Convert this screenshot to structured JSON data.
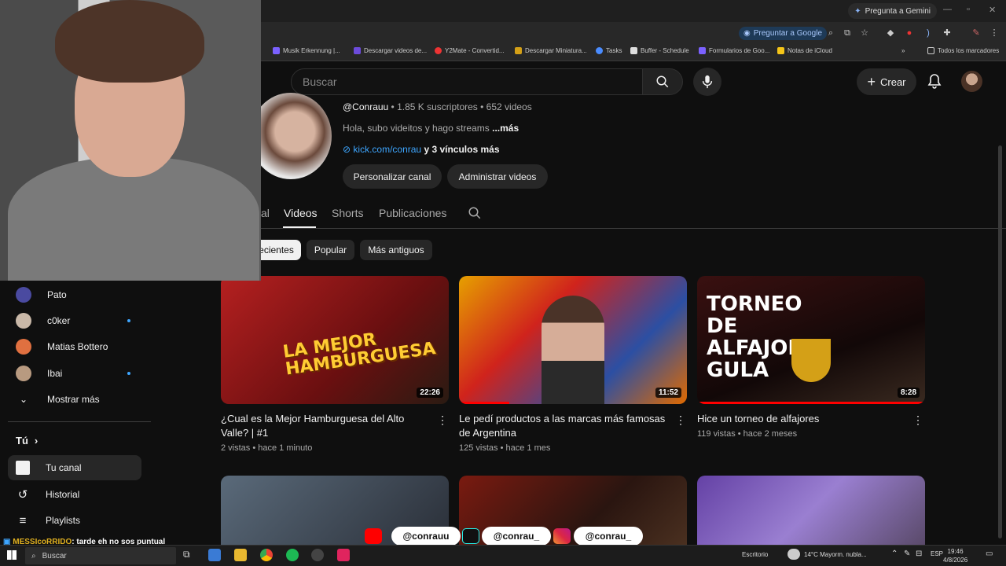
{
  "browser": {
    "gemini_label": "Pregunta a Gemini",
    "google_button": "Preguntar a Google",
    "bookmarks": [
      "Musik Erkennung |...",
      "Descargar videos de...",
      "Y2Mate - Convertid...",
      "Descargar Miniatura...",
      "Tasks",
      "Buffer - Schedule",
      "Formularios de Goo...",
      "Notas de iCloud"
    ],
    "bookmarks_overflow": "»",
    "all_bookmarks": "Todos los marcadores"
  },
  "header": {
    "search_placeholder": "Buscar",
    "create_label": "Crear"
  },
  "channel": {
    "handle": "@Conrauu",
    "stats": " • 1.85 K suscriptores • 652 videos",
    "description": "Hola, subo videitos y hago streams ",
    "more": "...más",
    "link": "kick.com/conrau",
    "more_links": " y 3 vínculos más",
    "customize_button": "Personalizar canal",
    "manage_button": "Administrar videos",
    "tabs": [
      "al",
      "Videos",
      "Shorts",
      "Publicaciones"
    ],
    "chips": [
      "ecientes",
      "Popular",
      "Más antiguos"
    ]
  },
  "sidebar": {
    "subscriptions": [
      {
        "name": "Pato"
      },
      {
        "name": "c0ker"
      },
      {
        "name": "Matias Bottero"
      },
      {
        "name": "Ibai"
      }
    ],
    "show_more": "Mostrar más",
    "you_label": "Tú",
    "nav": [
      "Tu canal",
      "Historial",
      "Playlists"
    ]
  },
  "videos": [
    {
      "title": "¿Cual es la Mejor Hamburguesa del Alto Valle? | #1",
      "meta": "2 vistas • hace 1 minuto",
      "duration": "22:26",
      "thumb_text": "LA MEJOR HAMBURGUESA",
      "progress": 0
    },
    {
      "title": "Le pedí productos a las marcas más famosas de Argentina",
      "meta": "125 vistas • hace 1 mes",
      "duration": "11:52",
      "thumb_text": "",
      "progress": 0.22
    },
    {
      "title": "Hice un torneo de alfajores",
      "meta": "119 vistas • hace 2 meses",
      "duration": "8:28",
      "thumb_text": "TORNEO DE ALFAJORES GULA",
      "progress": 1
    }
  ],
  "social": [
    "@conrauu",
    "@conrau_",
    "@conrau_"
  ],
  "chat": {
    "user": "MESSIcoRRIDO",
    "message": ": tarde eh no sos puntual"
  },
  "taskbar": {
    "search": "Buscar",
    "desktop": "Escritorio",
    "weather": "14°C  Mayorm. nubla...",
    "lang": "ESP",
    "time": "19:46",
    "date": "4/8/2026"
  },
  "colors": {
    "accent": "#ff0000",
    "link": "#3ea6ff",
    "background": "#0f0f0f"
  }
}
